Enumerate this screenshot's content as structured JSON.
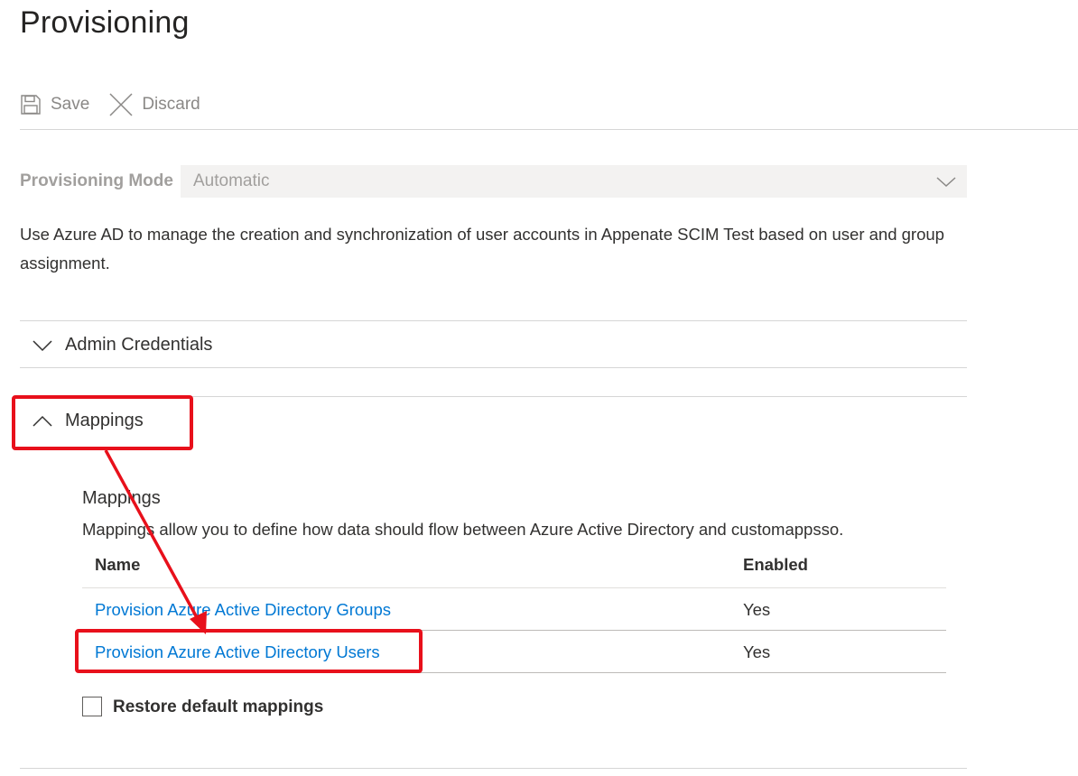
{
  "page": {
    "title": "Provisioning"
  },
  "toolbar": {
    "save_label": "Save",
    "discard_label": "Discard"
  },
  "provisioning_mode": {
    "label": "Provisioning Mode",
    "value": "Automatic"
  },
  "description": "Use Azure AD to manage the creation and synchronization of user accounts in Appenate SCIM Test based on user and group assignment.",
  "sections": {
    "admin_credentials": {
      "label": "Admin Credentials",
      "expanded": false
    },
    "mappings": {
      "label": "Mappings",
      "expanded": true
    }
  },
  "mappings": {
    "title": "Mappings",
    "description": "Mappings allow you to define how data should flow between Azure Active Directory and customappsso.",
    "columns": {
      "name": "Name",
      "enabled": "Enabled"
    },
    "rows": [
      {
        "name": "Provision Azure Active Directory Groups",
        "enabled": "Yes"
      },
      {
        "name": "Provision Azure Active Directory Users",
        "enabled": "Yes"
      }
    ],
    "restore_label": "Restore default mappings"
  },
  "annotation": {
    "color": "#e8101b"
  }
}
